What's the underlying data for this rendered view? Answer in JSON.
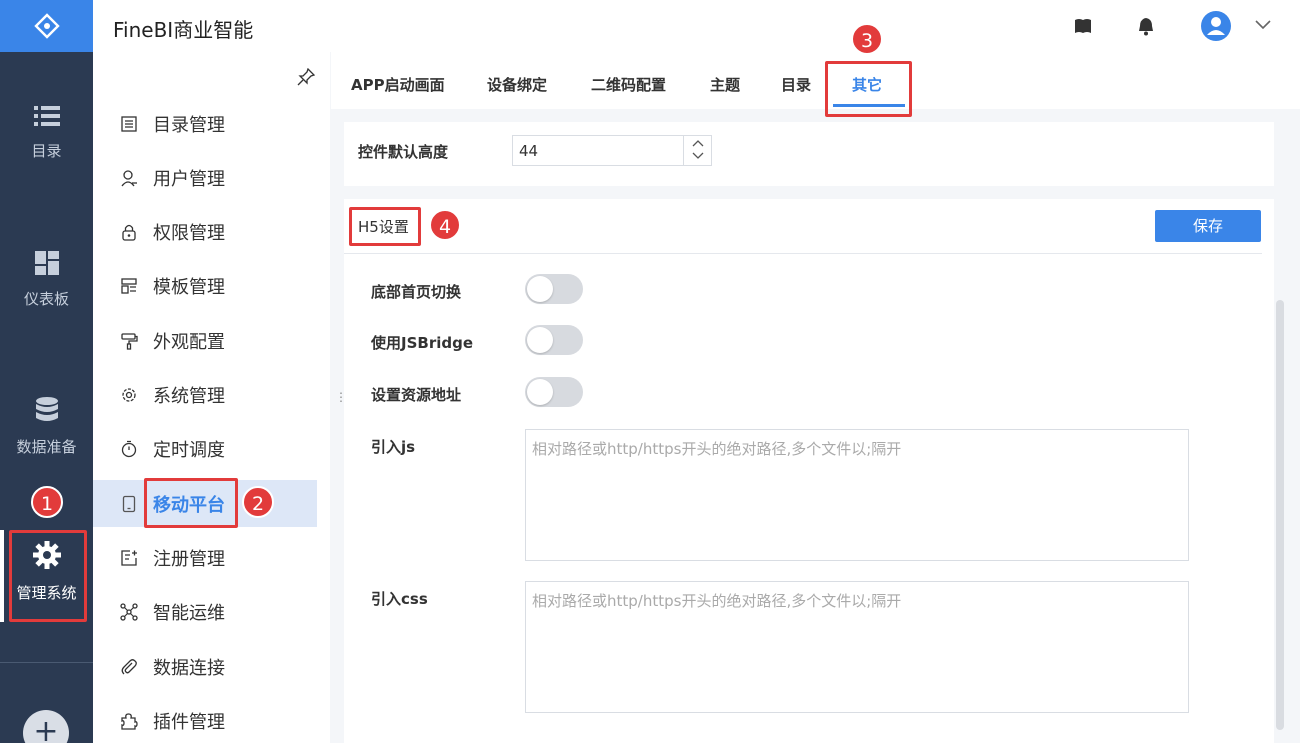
{
  "header": {
    "title": "FineBI商业智能"
  },
  "leftnav": {
    "items": [
      {
        "label": "目录"
      },
      {
        "label": "仪表板"
      },
      {
        "label": "数据准备"
      },
      {
        "label": "管理系统"
      }
    ],
    "add": "+"
  },
  "sidebar": {
    "items": [
      {
        "label": "目录管理"
      },
      {
        "label": "用户管理"
      },
      {
        "label": "权限管理"
      },
      {
        "label": "模板管理"
      },
      {
        "label": "外观配置"
      },
      {
        "label": "系统管理"
      },
      {
        "label": "定时调度"
      },
      {
        "label": "移动平台"
      },
      {
        "label": "注册管理"
      },
      {
        "label": "智能运维"
      },
      {
        "label": "数据连接"
      },
      {
        "label": "插件管理"
      }
    ]
  },
  "tabs": [
    {
      "label": "APP启动画面"
    },
    {
      "label": "设备绑定"
    },
    {
      "label": "二维码配置"
    },
    {
      "label": "主题"
    },
    {
      "label": "目录"
    },
    {
      "label": "其它"
    }
  ],
  "control_height": {
    "label": "控件默认高度",
    "value": "44"
  },
  "h5": {
    "title": "H5设置",
    "save_label": "保存",
    "toggles": [
      {
        "label": "底部首页切换",
        "on": false
      },
      {
        "label": "使用JSBridge",
        "on": false
      },
      {
        "label": "设置资源地址",
        "on": false
      }
    ],
    "js": {
      "label": "引入js",
      "placeholder": "相对路径或http/https开头的绝对路径,多个文件以;隔开"
    },
    "css": {
      "label": "引入css",
      "placeholder": "相对路径或http/https开头的绝对路径,多个文件以;隔开"
    }
  },
  "annotations": [
    "1",
    "2",
    "3",
    "4"
  ],
  "colors": {
    "accent": "#3a85e8",
    "nav": "#2b3a52",
    "annotation": "#e23b3b"
  }
}
